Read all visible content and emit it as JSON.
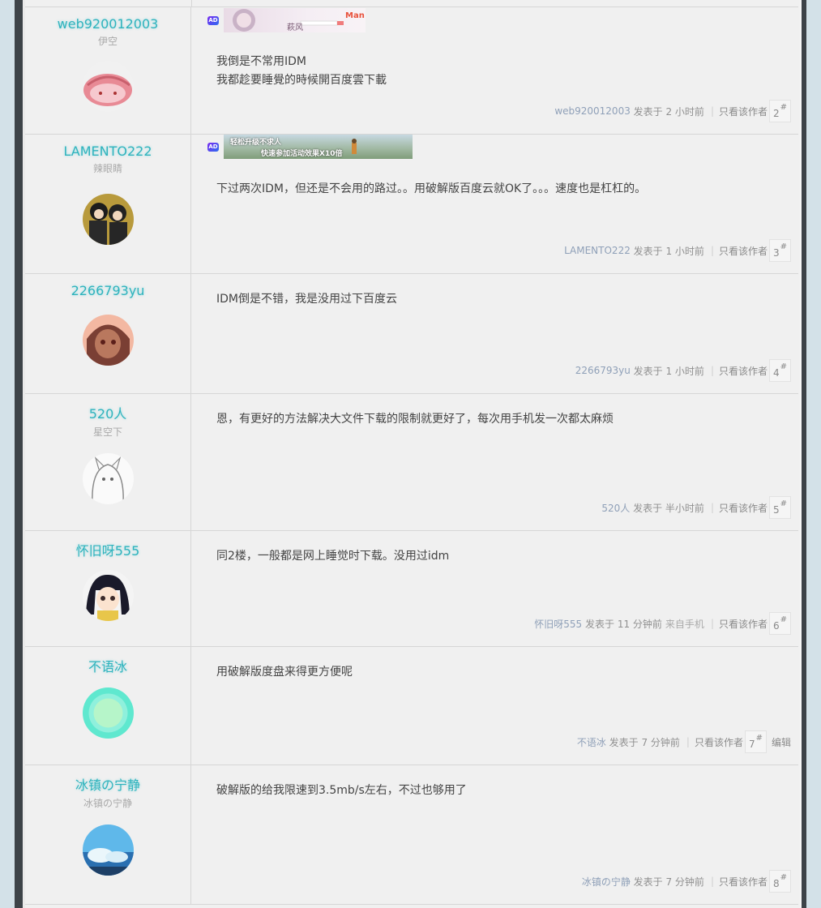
{
  "ad_badge": "AD",
  "ads": {
    "ad1_text": "萩风",
    "ad1_brand": "Man",
    "ad2_line1": "轻松升级不求人",
    "ad2_line2": "快速参加活动效果X10倍"
  },
  "posts": [
    {
      "username": "web920012003",
      "title": "伊空",
      "lines": [
        "我倒是不常用IDM",
        "我都趁要睡覺的時候開百度雲下載"
      ],
      "meta_user": "web920012003",
      "meta_time": "发表于 2 小时前",
      "only_author": "只看该作者",
      "floor": "2"
    },
    {
      "username": "LAMENTO222",
      "title": "辣眼睛",
      "lines": [
        "下过两次IDM，但还是不会用的路过。。用破解版百度云就OK了。。。速度也是杠杠的。"
      ],
      "meta_user": "LAMENTO222",
      "meta_time": "发表于 1 小时前",
      "only_author": "只看该作者",
      "floor": "3"
    },
    {
      "username": "2266793yu",
      "title": "",
      "lines": [
        "IDM倒是不错，我是没用过下百度云"
      ],
      "meta_user": "2266793yu",
      "meta_time": "发表于 1 小时前",
      "only_author": "只看该作者",
      "floor": "4"
    },
    {
      "username": "520人",
      "title": "星空下",
      "lines": [
        "恩，有更好的方法解决大文件下载的限制就更好了，每次用手机发一次都太麻烦"
      ],
      "meta_user": "520人",
      "meta_time": "发表于 半小时前",
      "only_author": "只看该作者",
      "floor": "5"
    },
    {
      "username": "怀旧呀555",
      "title": "",
      "lines": [
        "同2楼，一般都是网上睡觉时下载。没用过idm"
      ],
      "meta_user": "怀旧呀555",
      "meta_time": "发表于 11 分钟前",
      "meta_source": "来自手机",
      "only_author": "只看该作者",
      "floor": "6"
    },
    {
      "username": "不语冰",
      "title": "",
      "lines": [
        "用破解版度盘来得更方便呢"
      ],
      "meta_user": "不语冰",
      "meta_time": "发表于 7 分钟前",
      "only_author": "只看该作者",
      "floor": "7",
      "edit": "编辑"
    },
    {
      "username": "冰镇の宁静",
      "title": "冰镇の宁静",
      "lines": [
        "破解版的给我限速到3.5mb/s左右，不过也够用了"
      ],
      "meta_user": "冰镇の宁静",
      "meta_time": "发表于 7 分钟前",
      "only_author": "只看该作者",
      "floor": "8"
    }
  ],
  "floor_mark": "#",
  "colors": {
    "username": "#2fb3bd",
    "meta_user": "#8fa0b8",
    "background": "#f0f0f0",
    "page_bg": "#d3e1e8"
  }
}
